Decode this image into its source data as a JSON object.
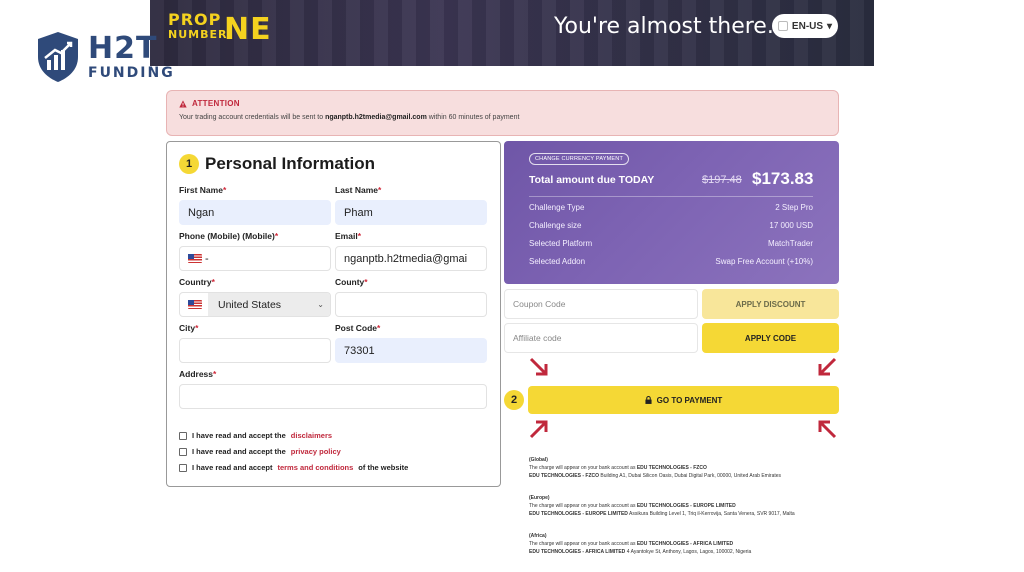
{
  "watermark": {
    "brand_top": "H2T",
    "brand_bottom": "FUNDING"
  },
  "banner": {
    "brand_line1": "PROP",
    "brand_line2": "NUMBER",
    "brand_big": "NE",
    "title": "You're almost there..",
    "language": "EN-US"
  },
  "attention": {
    "heading": "ATTENTION",
    "text_prefix": "Your trading account credentials will be sent to",
    "email": "nganptb.h2tmedia@gmail.com",
    "text_suffix": "within 60 minutes of payment"
  },
  "personal": {
    "step": "1",
    "title": "Personal Information",
    "first_name_label": "First Name",
    "first_name_value": "Ngan",
    "last_name_label": "Last Name",
    "last_name_value": "Pham",
    "phone_label": "Phone (Mobile) (Mobile)",
    "phone_prefix": "-",
    "email_label": "Email",
    "email_value": "nganptb.h2tmedia@gmai",
    "country_label": "Country",
    "country_value": "United States",
    "county_label": "County",
    "city_label": "City",
    "post_code_label": "Post Code",
    "post_code_value": "73301",
    "address_label": "Address",
    "required_mark": "*",
    "checks": [
      {
        "prefix": "I have read and accept the",
        "link": "disclaimers",
        "suffix": ""
      },
      {
        "prefix": "I have read and accept the",
        "link": "privacy policy",
        "suffix": ""
      },
      {
        "prefix": "I have read and accept",
        "link": "terms and conditions",
        "suffix": "of the website"
      }
    ]
  },
  "summary": {
    "change_currency": "CHANGE CURRENCY PAYMENT",
    "total_label": "Total amount due TODAY",
    "old_price": "$197.48",
    "new_price": "$173.83",
    "rows": [
      {
        "label": "Challenge Type",
        "value": "2 Step Pro"
      },
      {
        "label": "Challenge size",
        "value": "17 000 USD"
      },
      {
        "label": "Selected Platform",
        "value": "MatchTrader"
      },
      {
        "label": "Selected Addon",
        "value": "Swap Free Account (+10%)"
      }
    ]
  },
  "coupon": {
    "placeholder": "Coupon Code",
    "button": "APPLY DISCOUNT"
  },
  "affiliate": {
    "placeholder": "Affiliate code",
    "button": "APPLY CODE"
  },
  "payment": {
    "step": "2",
    "button": "GO TO PAYMENT"
  },
  "legal": [
    {
      "heading": "(Global)",
      "line1_prefix": "The charge will appear on your bank account as",
      "line1_bold": "EDU TECHNOLOGIES - FZCO",
      "line2_bold": "EDU TECHNOLOGIES - FZCO",
      "line2_rest": "Building A1, Dubai Silicon Oasis, Dubai Digital Park, 00000, United Arab Emirates"
    },
    {
      "heading": "(Europe)",
      "line1_prefix": "The charge will appear on your bank account as",
      "line1_bold": "EDU TECHNOLOGIES - EUROPE LIMITED",
      "line2_bold": "EDU TECHNOLOGIES - EUROPE LIMITED",
      "line2_rest": "Assikura Building Level 1, Triq il-Kerrovija, Santa Venera, SVR 9017, Malta"
    },
    {
      "heading": "(Africa)",
      "line1_prefix": "The charge will appear on your bank account as",
      "line1_bold": "EDU TECHNOLOGIES - AFRICA LIMITED",
      "line2_bold": "EDU TECHNOLOGIES - AFRICA LIMITED",
      "line2_rest": "4 Ayantokye St, Anthony, Lagos, Lagos, 100002, Nigeria"
    }
  ]
}
